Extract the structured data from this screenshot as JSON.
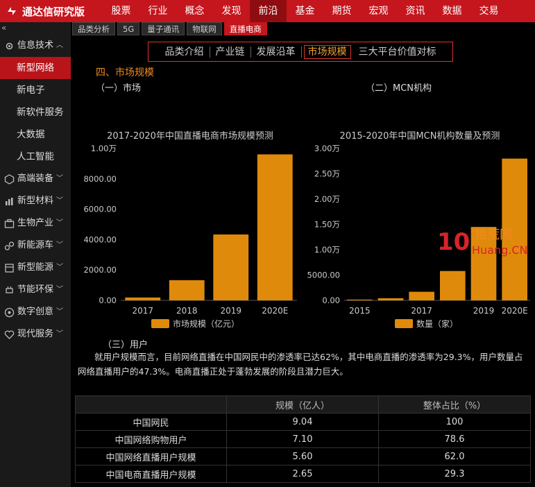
{
  "app": {
    "title": "通达信研究版"
  },
  "topnav": [
    "股票",
    "行业",
    "概念",
    "发现",
    "前沿",
    "基金",
    "期货",
    "宏观",
    "资讯",
    "数据",
    "交易"
  ],
  "topnav_active": 4,
  "sidebar": {
    "collapse": "«",
    "groups": [
      {
        "label": "信息技术",
        "icon": "chip-icon",
        "open": true,
        "items": [
          "新型网络",
          "新电子",
          "新软件服务",
          "大数据",
          "人工智能"
        ],
        "active": 0
      },
      {
        "label": "高端装备",
        "icon": "hexagon-icon"
      },
      {
        "label": "新型材料",
        "icon": "bar-icon"
      },
      {
        "label": "生物产业",
        "icon": "briefcase-icon"
      },
      {
        "label": "新能源车",
        "icon": "link-icon"
      },
      {
        "label": "新型能源",
        "icon": "box-icon"
      },
      {
        "label": "节能环保",
        "icon": "plug-icon"
      },
      {
        "label": "数字创意",
        "icon": "circle-icon"
      },
      {
        "label": "现代服务",
        "icon": "heart-icon"
      }
    ]
  },
  "subtabs": [
    "品类分析",
    "5G",
    "量子通讯",
    "物联网",
    "直播电商"
  ],
  "subtabs_active": 4,
  "pagenav": [
    "品类介绍",
    "产业链",
    "发展沿革",
    "市场规模",
    "三大平台价值对标"
  ],
  "pagenav_active": 3,
  "section_title": "四、市场规模",
  "sub1": "（一）市场",
  "sub2": "（二）MCN机构",
  "sub3": "（三）用户",
  "paragraph": "就用户规模而言，目前网络直播在中国网民中的渗透率已达62%，其中电商直播的渗透率为29.3%，用户数量占网络直播用户的47.3%。电商直播正处于蓬勃发展的阶段且潜力巨大。",
  "chart_data": [
    {
      "type": "bar",
      "title": "2017-2020年中国直播电商市场规模预测",
      "categories": [
        "2017",
        "2018",
        "2019",
        "2020E"
      ],
      "values": [
        190,
        1330,
        4338,
        9610
      ],
      "ylim": [
        0,
        10000
      ],
      "yticks": [
        "0.00",
        "2000.00",
        "4000.00",
        "6000.00",
        "8000.00",
        "1.00万"
      ],
      "legend": "市场规模（亿元）",
      "color": "#e08a0b"
    },
    {
      "type": "bar",
      "title": "2015-2020年中国MCN机构数量及预测",
      "categories": [
        "2015",
        "2016",
        "2017",
        "2018",
        "2019",
        "2020E"
      ],
      "xtick_labels": [
        "2015",
        "",
        "2017",
        "",
        "2019",
        "2020E"
      ],
      "values": [
        160,
        420,
        1700,
        5800,
        14500,
        28000
      ],
      "ylim": [
        0,
        30000
      ],
      "yticks": [
        "0.00",
        "5000.00",
        "1.00万",
        "1.50万",
        "2.00万",
        "2.50万",
        "3.00万"
      ],
      "legend": "数量（家）",
      "color": "#e08a0b"
    }
  ],
  "table": {
    "headers": [
      "",
      "规模（亿人）",
      "整体占比（%）"
    ],
    "rows": [
      [
        "中国网民",
        "9.04",
        "100"
      ],
      [
        "中国网络购物用户",
        "7.10",
        "78.6"
      ],
      [
        "中国网络直播用户规模",
        "5.60",
        "62.0"
      ],
      [
        "中国电商直播用户规模",
        "2.65",
        "29.3"
      ]
    ]
  },
  "watermark": {
    "logo": "10",
    "text1": "拾荒网",
    "text2": "Huang.CN"
  }
}
